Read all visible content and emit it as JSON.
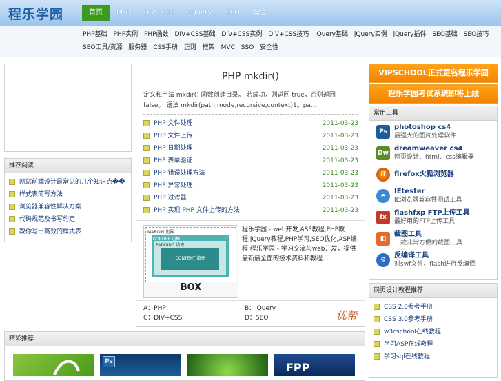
{
  "header": {
    "logo": "程乐学园",
    "nav": [
      "首页",
      "PHP",
      "DIV+CSS",
      "jQuery",
      "SEO",
      "留言"
    ]
  },
  "subnav": [
    "PHP基础",
    "PHP实例",
    "PHP函数",
    "DIV+CSS基础",
    "DIV+CSS实例",
    "DIV+CSS技巧",
    "jQuery基础",
    "jQuery实例",
    "jQuery插件",
    "SEO基础",
    "SEO技巧",
    "SEO工具/资源",
    "服务器",
    "CSS手册",
    "正则",
    "框架",
    "MVC",
    "SSO",
    "安全性"
  ],
  "left": {
    "box1_title": "推荐阅读",
    "items": [
      "网站前端设计最常见的几个知识点��",
      "样式表简写方法",
      "浏览器兼容性解决方案",
      "代码规范及书写约定",
      "教你写出高效的样式表"
    ]
  },
  "main": {
    "title": "PHP mkdir()",
    "desc": "定义和用法 mkdir() 函数创建目录。 若成功，则返回 true，否则返回 false。 语法 mkdir(path,mode,recursive,context)1。pa...",
    "news": [
      {
        "t": "PHP 文件处理",
        "d": "2011-03-23"
      },
      {
        "t": "PHP 文件上传",
        "d": "2011-03-23"
      },
      {
        "t": "PHP 日期处理",
        "d": "2011-03-23"
      },
      {
        "t": "PHP 表单验证",
        "d": "2011-03-23"
      },
      {
        "t": "PHP 错误处理方法",
        "d": "2011-03-23"
      },
      {
        "t": "PHP 异常处理",
        "d": "2011-03-23"
      },
      {
        "t": "PHP 过滤器",
        "d": "2011-03-23"
      },
      {
        "t": "PHP 实现 PHP 文件上传的方法",
        "d": "2011-03-23"
      }
    ],
    "about": "程乐学园 - web开发,ASP教程,PHP教程,jQuery教程,PHP学习,SEO优化,ASP编程,程乐学园 - 学习交流与web开发，提供最新最全面的技术资料和教程…",
    "boxmodel": {
      "margin": "MARGIN 边界",
      "border": "BORDER 边框",
      "padding": "PADDING 填充",
      "content": "CONTENT 填充",
      "caption": "BOX"
    },
    "quiz": [
      "A：PHP",
      "B：jQuery",
      "C：DIV+CSS",
      "D：SEO"
    ],
    "seal": "优帮"
  },
  "right": {
    "btn1": "VIPSCHOOL正式更名程乐学园",
    "btn2": "程乐学园考试系统即将上线",
    "tools_title": "常用工具",
    "tools": [
      {
        "icon": "Ps",
        "name": "photoshop cs4",
        "desc": "最强大的图片处理软件"
      },
      {
        "icon": "Dw",
        "name": "dreamweaver cs4",
        "desc": "网页设计、html、css编辑器"
      },
      {
        "icon": "ff",
        "name": "firefox火狐浏览器",
        "desc": ""
      },
      {
        "icon": "e",
        "name": "IEtester",
        "desc": "IE浏览器兼容性测试工具"
      },
      {
        "icon": "fx",
        "name": "flashfxp FTP上传工具",
        "desc": "最好用的FTP上传工具"
      },
      {
        "icon": "◧",
        "name": "截图工具",
        "desc": "一款非常方便的截图工具"
      },
      {
        "icon": "⚙",
        "name": "反编译工具",
        "desc": "对swf文件、flash进行反编译"
      }
    ],
    "links_title": "网页设计教程推荐",
    "links": [
      "CSS 2.0参考手册",
      "CSS 3.0参考手册",
      "w3cschool在线教程",
      "学习ASP在线教程",
      "学习sql在线教程"
    ]
  },
  "bottom": {
    "title": "精彩推荐"
  }
}
